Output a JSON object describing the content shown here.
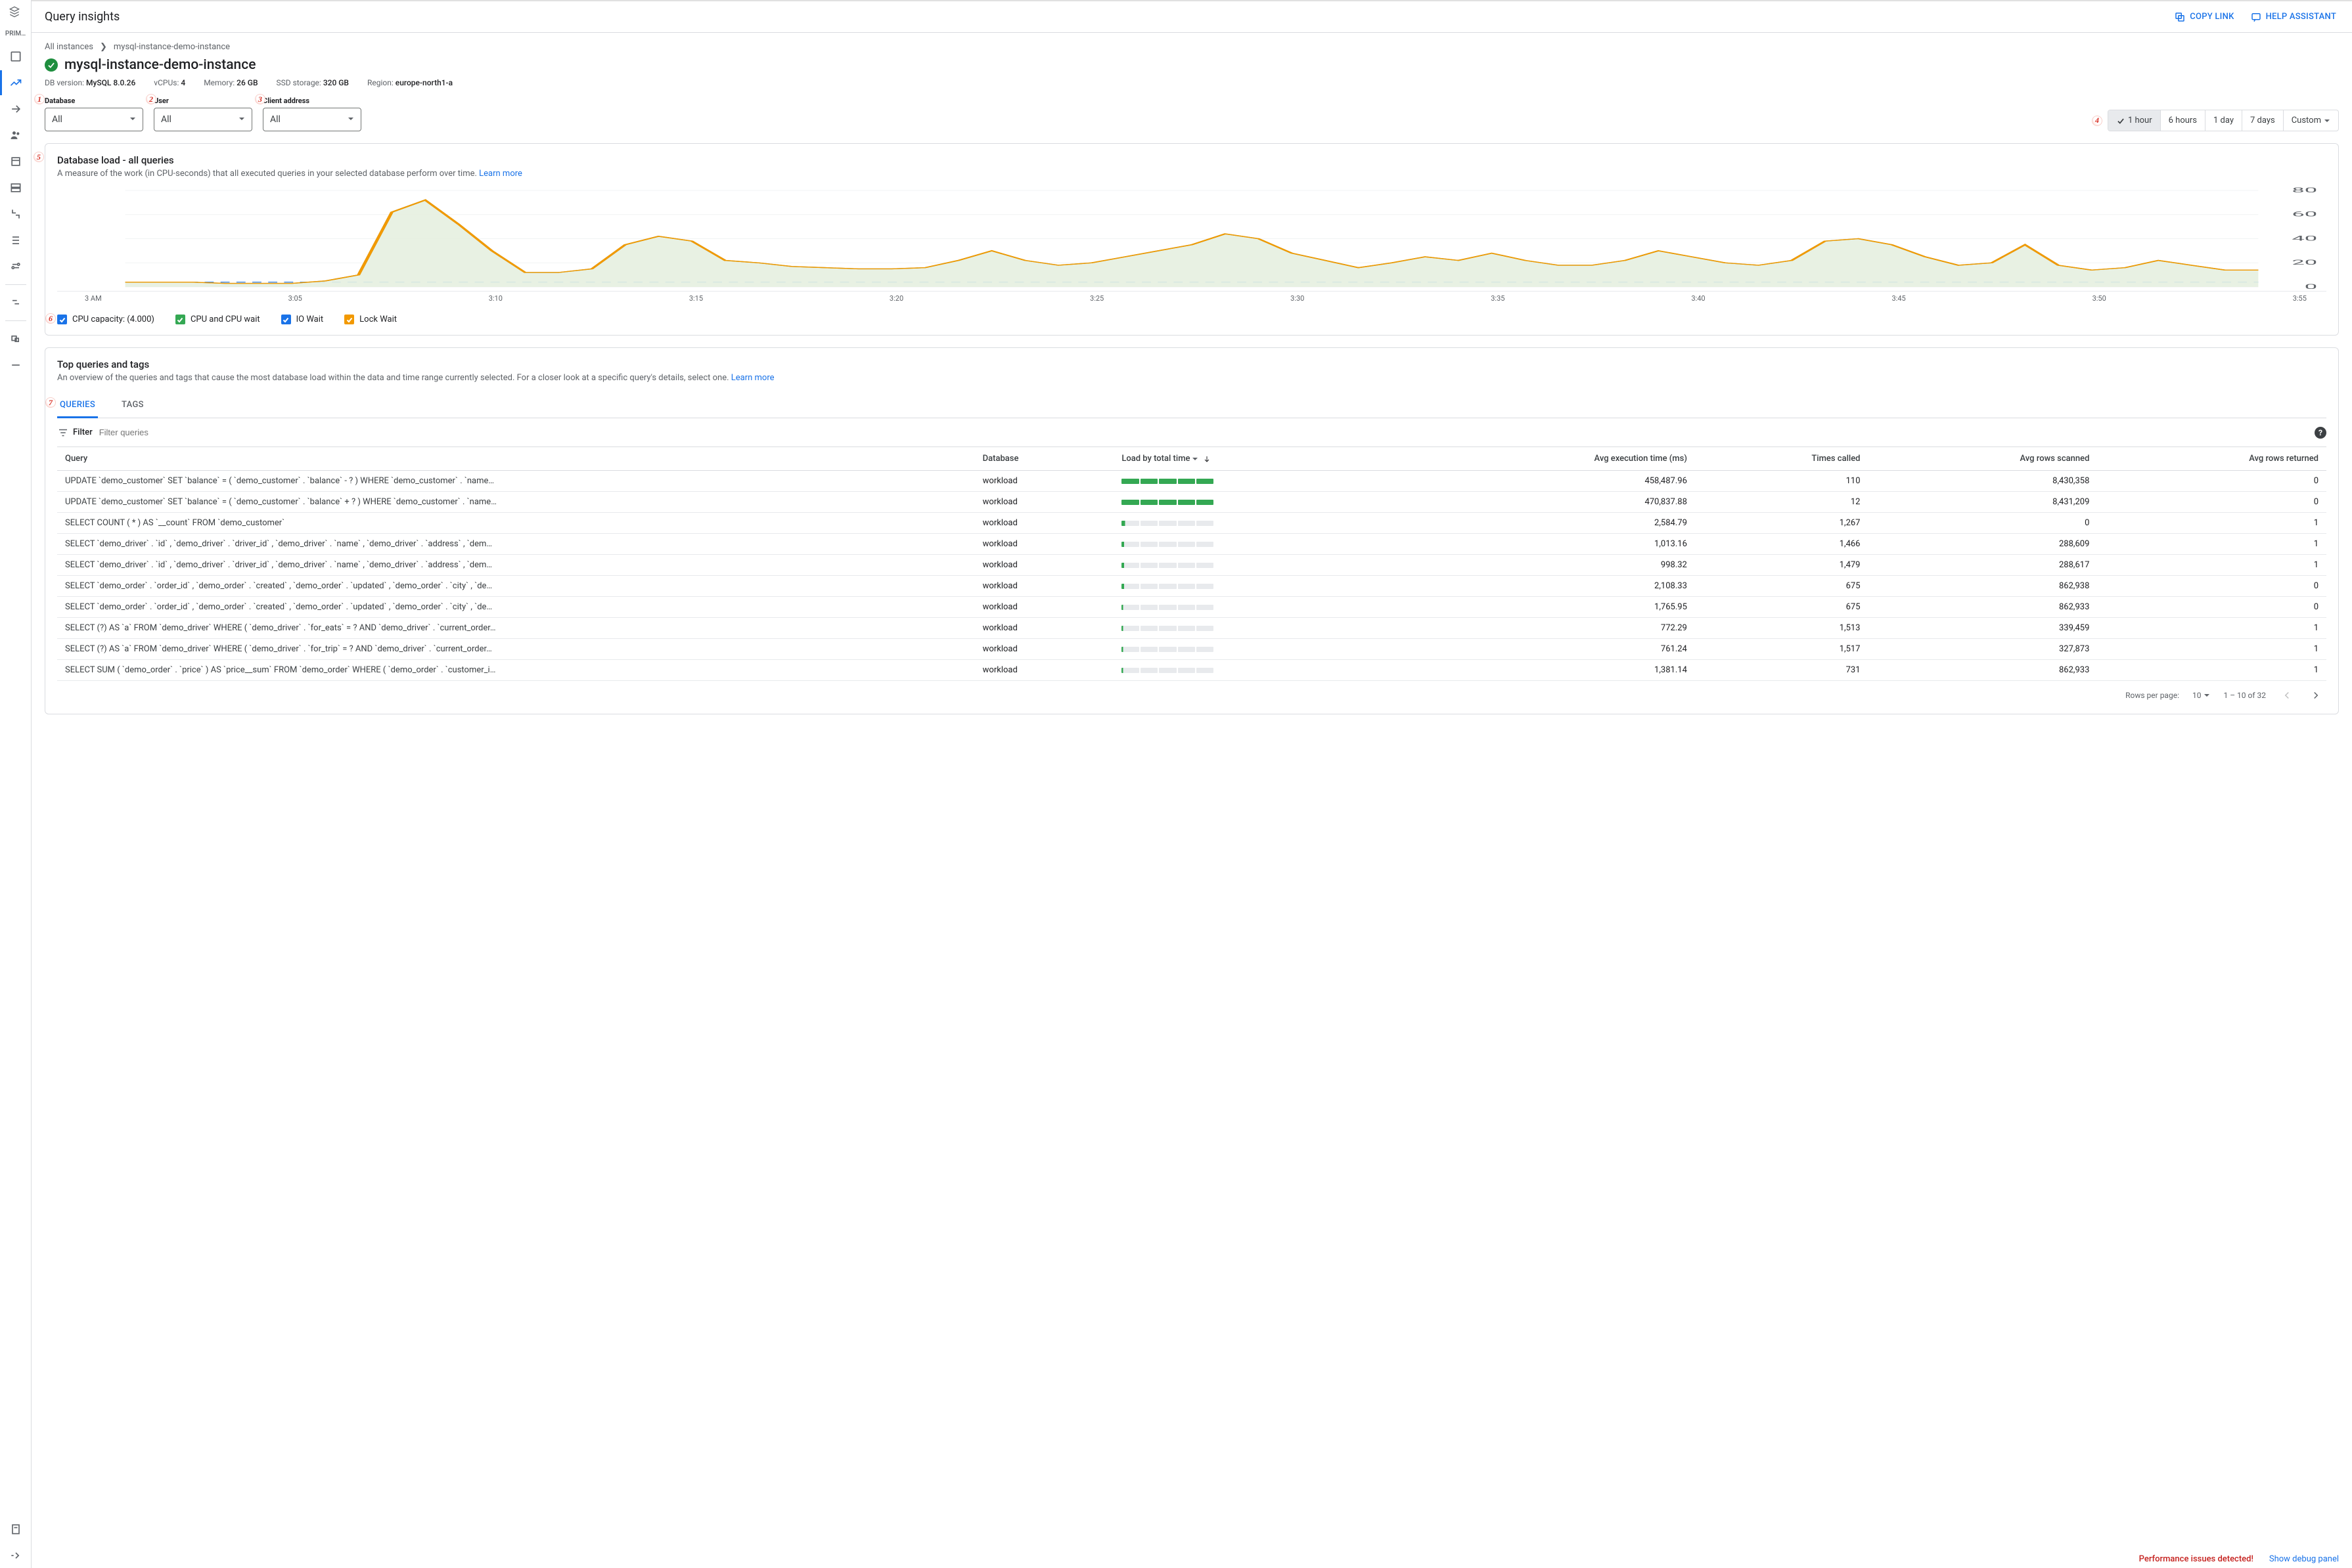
{
  "rail": {
    "project_label": "PRIM…"
  },
  "topbar": {
    "title": "Query insights",
    "copy_link": "COPY LINK",
    "help_assistant": "HELP ASSISTANT"
  },
  "breadcrumb": {
    "root": "All instances",
    "current": "mysql-instance-demo-instance"
  },
  "instance": {
    "name": "mysql-instance-demo-instance",
    "meta": [
      {
        "k": "DB version:",
        "v": "MySQL 8.0.26"
      },
      {
        "k": "vCPUs:",
        "v": "4"
      },
      {
        "k": "Memory:",
        "v": "26 GB"
      },
      {
        "k": "SSD storage:",
        "v": "320 GB"
      },
      {
        "k": "Region:",
        "v": "europe-north1-a"
      }
    ]
  },
  "filters": {
    "database": {
      "label": "Database",
      "value": "All"
    },
    "user": {
      "label": "User",
      "value": "All"
    },
    "client": {
      "label": "Client address",
      "value": "All"
    }
  },
  "time_segments": [
    "1 hour",
    "6 hours",
    "1 day",
    "7 days",
    "Custom"
  ],
  "time_active": 0,
  "load_card": {
    "title": "Database load - all queries",
    "subtitle": "A measure of the work (in CPU-seconds) that all executed queries in your selected database perform over time. ",
    "learn_more": "Learn more",
    "legend": [
      {
        "label": "CPU capacity: (4.000)",
        "color": "#1a73e8"
      },
      {
        "label": "CPU and CPU wait",
        "color": "#34a853"
      },
      {
        "label": "IO Wait",
        "color": "#1a73e8"
      },
      {
        "label": "Lock Wait",
        "color": "#f29900"
      }
    ]
  },
  "chart_data": {
    "type": "area",
    "xlabels": [
      "3 AM",
      "3:05",
      "3:10",
      "3:15",
      "3:20",
      "3:25",
      "3:30",
      "3:35",
      "3:40",
      "3:45",
      "3:50",
      "3:55"
    ],
    "ylim": [
      0,
      80
    ],
    "yticks": [
      0,
      20,
      40,
      60,
      80
    ],
    "cpu_capacity": 4.0,
    "series": [
      {
        "name": "CPU and CPU wait",
        "color": "#e6efe0",
        "stroke": "#7fa86f",
        "values": [
          4,
          4,
          4,
          3,
          3,
          3,
          5,
          10,
          62,
          72,
          52,
          30,
          12,
          12,
          15,
          35,
          42,
          38,
          22,
          20,
          17,
          16,
          15,
          15,
          16,
          22,
          30,
          22,
          18,
          20,
          25,
          30,
          35,
          44,
          40,
          28,
          22,
          16,
          20,
          25,
          22,
          28,
          22,
          18,
          18,
          22,
          30,
          25,
          20,
          18,
          22,
          38,
          40,
          35,
          25,
          18,
          20,
          35,
          18,
          14,
          16,
          22,
          18,
          14,
          14
        ]
      },
      {
        "name": "IO Wait",
        "color": "#1a73e8",
        "stroke": "#1a73e8",
        "values": []
      },
      {
        "name": "Lock Wait",
        "color": "#f29900",
        "stroke": "#f29900",
        "values": [
          4,
          4,
          4,
          3,
          3,
          3,
          5,
          10,
          62,
          72,
          52,
          30,
          12,
          12,
          15,
          35,
          42,
          38,
          22,
          20,
          17,
          16,
          15,
          15,
          16,
          22,
          30,
          22,
          18,
          20,
          25,
          30,
          35,
          44,
          40,
          28,
          22,
          16,
          20,
          25,
          22,
          28,
          22,
          18,
          18,
          22,
          30,
          25,
          20,
          18,
          22,
          38,
          40,
          35,
          25,
          18,
          20,
          35,
          18,
          14,
          16,
          22,
          18,
          14,
          14
        ]
      }
    ]
  },
  "top_queries": {
    "title": "Top queries and tags",
    "subtitle": "An overview of the queries and tags that cause the most database load within the data and time range currently selected. For a closer look at a specific query's details, select one. ",
    "learn_more": "Learn more",
    "tabs": [
      "QUERIES",
      "TAGS"
    ],
    "active_tab": 0,
    "filter_label": "Filter",
    "filter_placeholder": "Filter queries",
    "columns": [
      "Query",
      "Database",
      "Load by total time",
      "Avg execution time (ms)",
      "Times called",
      "Avg rows scanned",
      "Avg rows returned"
    ],
    "rows": [
      {
        "q": "UPDATE `demo_customer` SET `balance` = ( `demo_customer` . `balance` - ? ) WHERE `demo_customer` . `name…",
        "db": "workload",
        "load": 1.0,
        "exec": "458,487.96",
        "called": "110",
        "scanned": "8,430,358",
        "returned": "0"
      },
      {
        "q": "UPDATE `demo_customer` SET `balance` = ( `demo_customer` . `balance` + ? ) WHERE `demo_customer` . `name…",
        "db": "workload",
        "load": 1.0,
        "exec": "470,837.88",
        "called": "12",
        "scanned": "8,431,209",
        "returned": "0"
      },
      {
        "q": "SELECT COUNT ( * ) AS `__count` FROM `demo_customer`",
        "db": "workload",
        "load": 0.04,
        "exec": "2,584.79",
        "called": "1,267",
        "scanned": "0",
        "returned": "1"
      },
      {
        "q": "SELECT `demo_driver` . `id` , `demo_driver` . `driver_id` , `demo_driver` . `name` , `demo_driver` . `address` , `dem…",
        "db": "workload",
        "load": 0.03,
        "exec": "1,013.16",
        "called": "1,466",
        "scanned": "288,609",
        "returned": "1"
      },
      {
        "q": "SELECT `demo_driver` . `id` , `demo_driver` . `driver_id` , `demo_driver` . `name` , `demo_driver` . `address` , `dem…",
        "db": "workload",
        "load": 0.03,
        "exec": "998.32",
        "called": "1,479",
        "scanned": "288,617",
        "returned": "1"
      },
      {
        "q": "SELECT `demo_order` . `order_id` , `demo_order` . `created` , `demo_order` . `updated` , `demo_order` . `city` , `de…",
        "db": "workload",
        "load": 0.03,
        "exec": "2,108.33",
        "called": "675",
        "scanned": "862,938",
        "returned": "0"
      },
      {
        "q": "SELECT `demo_order` . `order_id` , `demo_order` . `created` , `demo_order` . `updated` , `demo_order` . `city` , `de…",
        "db": "workload",
        "load": 0.02,
        "exec": "1,765.95",
        "called": "675",
        "scanned": "862,933",
        "returned": "0"
      },
      {
        "q": "SELECT (?) AS `a` FROM `demo_driver` WHERE ( `demo_driver` . `for_eats` = ? AND `demo_driver` . `current_order…",
        "db": "workload",
        "load": 0.02,
        "exec": "772.29",
        "called": "1,513",
        "scanned": "339,459",
        "returned": "1"
      },
      {
        "q": "SELECT (?) AS `a` FROM `demo_driver` WHERE ( `demo_driver` . `for_trip` = ? AND `demo_driver` . `current_order…",
        "db": "workload",
        "load": 0.02,
        "exec": "761.24",
        "called": "1,517",
        "scanned": "327,873",
        "returned": "1"
      },
      {
        "q": "SELECT SUM ( `demo_order` . `price` ) AS `price__sum` FROM `demo_order` WHERE ( `demo_order` . `customer_i…",
        "db": "workload",
        "load": 0.02,
        "exec": "1,381.14",
        "called": "731",
        "scanned": "862,933",
        "returned": "1"
      }
    ],
    "pager": {
      "rows_label": "Rows per page:",
      "rows_per_page": "10",
      "range": "1 – 10 of 32"
    }
  },
  "footer": {
    "warn": "Performance issues detected!",
    "debug": "Show debug panel"
  }
}
